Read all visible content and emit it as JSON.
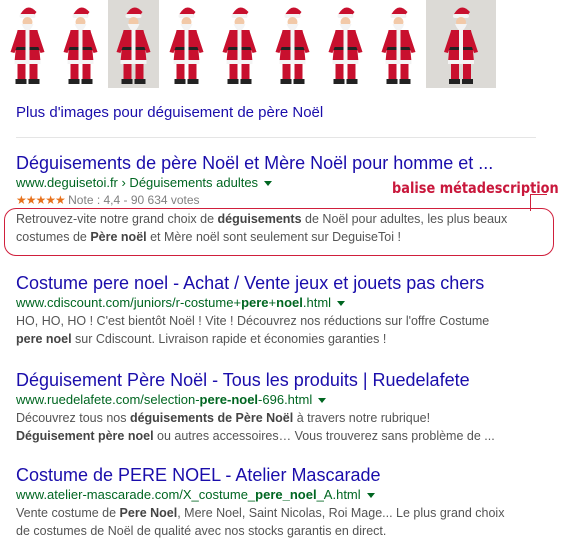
{
  "more_images_link": "Plus d'images pour déguisement de père Noël",
  "annotation": "balise métadescription",
  "colors": {
    "link": "#1a0dab",
    "url": "#006621",
    "snippet": "#545454",
    "stars": "#e7711b",
    "annotation": "#c9183c"
  },
  "image_thumbnails": [
    {
      "icon": "santa-costume-photo"
    },
    {
      "icon": "santa-costume-photo"
    },
    {
      "icon": "santa-costume-photo"
    },
    {
      "icon": "santa-costume-photo"
    },
    {
      "icon": "santa-costume-photo"
    },
    {
      "icon": "santa-costume-photo"
    },
    {
      "icon": "santa-costume-photo"
    },
    {
      "icon": "santa-costume-photo"
    },
    {
      "icon": "santa-costume-photo"
    }
  ],
  "results": [
    {
      "title": "Déguisements de père Noël et Mère Noël pour homme et ...",
      "url": "www.deguisetoi.fr › Déguisements adultes",
      "rating_stars": "★★★★★",
      "rating_text": "Note : 4,4 - 90 634 votes",
      "snippet_line1": [
        "Retrouvez-vite notre grand choix de ",
        "déguisements",
        " de Noël pour adultes, les plus beaux"
      ],
      "snippet_line2": [
        "costumes de ",
        "Père noël",
        " et Mère noël sont seulement sur DeguiseToi !"
      ]
    },
    {
      "title": "Costume pere noel - Achat / Vente jeux et jouets pas chers",
      "url": [
        "www.cdiscount.com/juniors/r-costume+",
        "pere",
        "+",
        "noel",
        ".html"
      ],
      "snippet_line1": [
        "HO, HO, HO ! C'est bientôt Noël ! Vite ! Découvrez nos réductions sur l'offre Costume"
      ],
      "snippet_line2": [
        "pere noel",
        " sur Cdiscount. Livraison rapide et économies garanties !"
      ]
    },
    {
      "title": "Déguisement Père Noël - Tous les produits | Ruedelafete",
      "url": [
        "www.ruedelafete.com/selection-",
        "pere-noel",
        "-696.html"
      ],
      "snippet_line1": [
        "Découvrez tous nos ",
        "déguisements de Père Noël",
        " à travers notre rubrique!"
      ],
      "snippet_line2": [
        "Déguisement père noel",
        " ou autres accessoires… Vous trouverez sans problème de ..."
      ]
    },
    {
      "title": "Costume de PERE NOEL - Atelier Mascarade",
      "url": [
        "www.atelier-mascarade.com/X_costume_",
        "pere_noel",
        "_A.html"
      ],
      "snippet_line1": [
        "Vente costume de ",
        "Pere Noel",
        ", Mere Noel, Saint Nicolas, Roi Mage... Le plus grand choix"
      ],
      "snippet_line2": [
        "de costumes de Noël de qualité avec nos stocks garantis en direct."
      ]
    }
  ]
}
